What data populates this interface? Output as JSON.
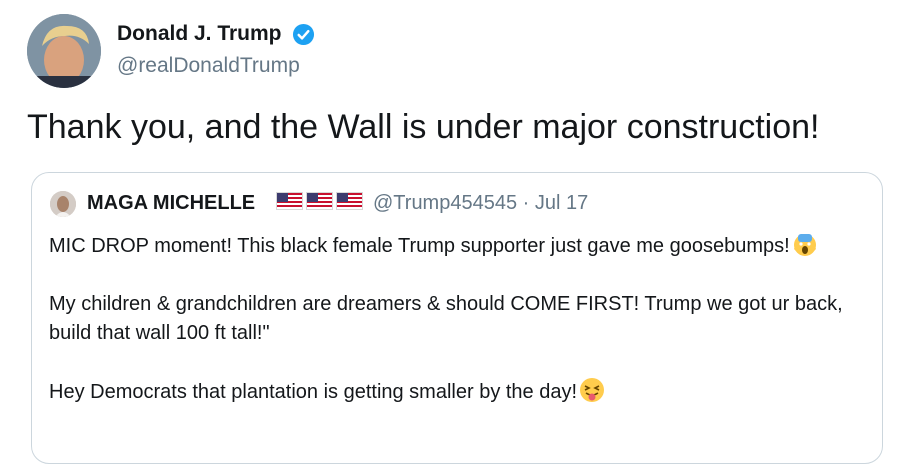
{
  "tweet": {
    "author_name": "Donald J. Trump",
    "author_handle": "@realDonaldTrump",
    "verified_icon": "verified-badge-icon",
    "text": "Thank you, and the Wall is under major construction!"
  },
  "quoted_tweet": {
    "author_name": "MAGA MICHELLE",
    "flags": [
      "us-flag-icon",
      "us-flag-icon",
      "us-flag-icon"
    ],
    "meta": "@Trump454545 · Jul 17",
    "paragraphs": [
      {
        "text": "MIC DROP moment! This black female Trump supporter just gave me goosebumps!",
        "emoji": "screaming-face-emoji"
      },
      {
        "text": "My children & grandchildren are dreamers & should COME FIRST! Trump we got ur back, build that wall 100 ft tall!\"",
        "emoji": ""
      },
      {
        "text": "Hey Democrats that plantation is getting smaller by the day!",
        "emoji": "tongue-out-winking-emoji"
      }
    ]
  },
  "colors": {
    "verified_blue": "#1da1f2",
    "secondary_text": "#657786",
    "border": "#ccd6dd"
  }
}
